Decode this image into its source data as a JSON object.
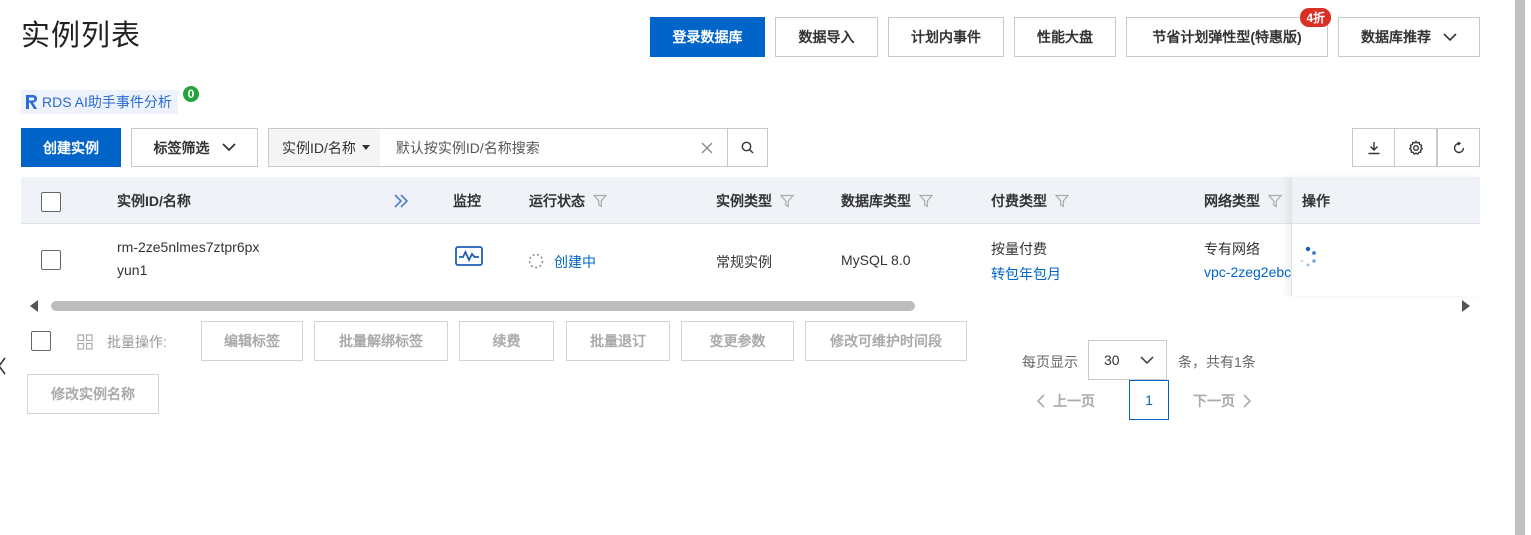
{
  "page": {
    "title": "实例列表"
  },
  "top_actions": [
    {
      "label": "登录数据库"
    },
    {
      "label": "数据导入"
    },
    {
      "label": "计划内事件"
    },
    {
      "label": "性能大盘"
    },
    {
      "label": "节省计划弹性型(特惠版)",
      "badge": "4折"
    },
    {
      "label": "数据库推荐"
    }
  ],
  "ai_assistant": {
    "label": "RDS AI助手事件分析",
    "count": "0"
  },
  "toolbar": {
    "create_label": "创建实例",
    "tag_filter_label": "标签筛选",
    "search_type": "实例ID/名称",
    "search_placeholder": "默认按实例ID/名称搜索",
    "download_icon": "download-icon",
    "settings_icon": "gear-icon",
    "refresh_icon": "refresh-icon"
  },
  "table": {
    "columns": [
      "实例ID/名称",
      "监控",
      "运行状态",
      "实例类型",
      "数据库类型",
      "付费类型",
      "网络类型",
      "操作"
    ],
    "rows": [
      {
        "instance_id": "rm-2ze5nlmes7ztpr6px",
        "instance_name": "yun1",
        "status": "创建中",
        "instance_type": "常规实例",
        "db_type": "MySQL 8.0",
        "pay_type": "按量付费",
        "pay_action": "转包年包月",
        "network_type": "专有网络",
        "vpc": "vpc-2zeg2ebc"
      }
    ],
    "scroll_fraction": 0.6
  },
  "bulk": {
    "label": "批量操作:",
    "actions": [
      "编辑标签",
      "批量解绑标签",
      "续费",
      "批量退订",
      "变更参数",
      "修改可维护时间段",
      "修改实例名称"
    ]
  },
  "pager": {
    "size_label": "每页显示",
    "page_size": "30",
    "total_label": "条，共有1条",
    "prev_label": "上一页",
    "next_label": "下一页",
    "current_page": "1"
  },
  "colors": {
    "primary": "#0064c8",
    "badge_red": "#d93026",
    "badge_green": "#22a43a"
  }
}
